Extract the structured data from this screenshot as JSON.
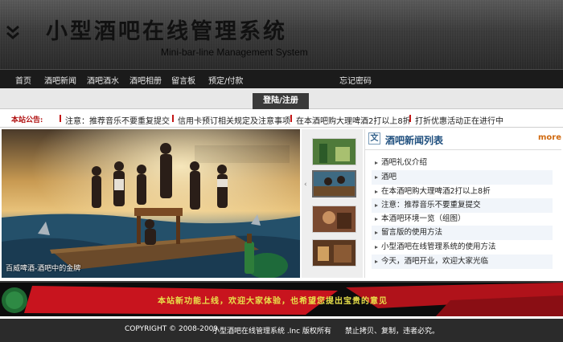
{
  "header": {
    "title_zh": "小型酒吧在线管理系统",
    "title_en": "Mini-bar-line Management System"
  },
  "nav": {
    "items": [
      "首页",
      "酒吧新闻",
      "酒吧酒水",
      "酒吧相册",
      "留言板",
      "预定/付款"
    ],
    "change_password": "忘记密码"
  },
  "login_tab": "登陆/注册",
  "notice": {
    "label": "本站公告:",
    "items": [
      "注意：推荐音乐不要重复提交",
      "信用卡预订相关规定及注意事项",
      "在本酒吧购大理啤酒2打以上8折",
      "打折优惠活动正在进行中"
    ]
  },
  "slideshow": {
    "caption": "百威啤酒-酒吧中的金牌"
  },
  "news": {
    "title": "酒吧新闻列表",
    "more": "more",
    "items": [
      "酒吧礼仪介绍",
      "酒吧",
      "在本酒吧购大理啤酒2打以上8折",
      "注意：推荐音乐不要重复提交",
      "本酒吧环境一览（组图）",
      "留言版的使用方法",
      "小型酒吧在线管理系统的使用方法",
      "今天，酒吧开业，欢迎大家光临"
    ]
  },
  "banner": {
    "text": "本站新功能上线，欢迎大家体验，也希望您提出宝贵的意见"
  },
  "footer": {
    "copyright": "COPYRIGHT © 2008-2009",
    "owner": "小型酒吧在线管理系统 .Inc 版权所有",
    "notice": "禁止拷贝、复制，违者必究。"
  },
  "colors": {
    "header_bg": "#3c3c3c",
    "nav_bg": "#1b1b1b",
    "notice_marker": "#c41616",
    "news_title": "#1f4f7e",
    "more": "#d06a10",
    "banner_text": "#e8e04a",
    "footer_bg": "#2b2b2b"
  },
  "icons": {
    "header": "double-chevron-down-icon",
    "news": "document-icon"
  }
}
